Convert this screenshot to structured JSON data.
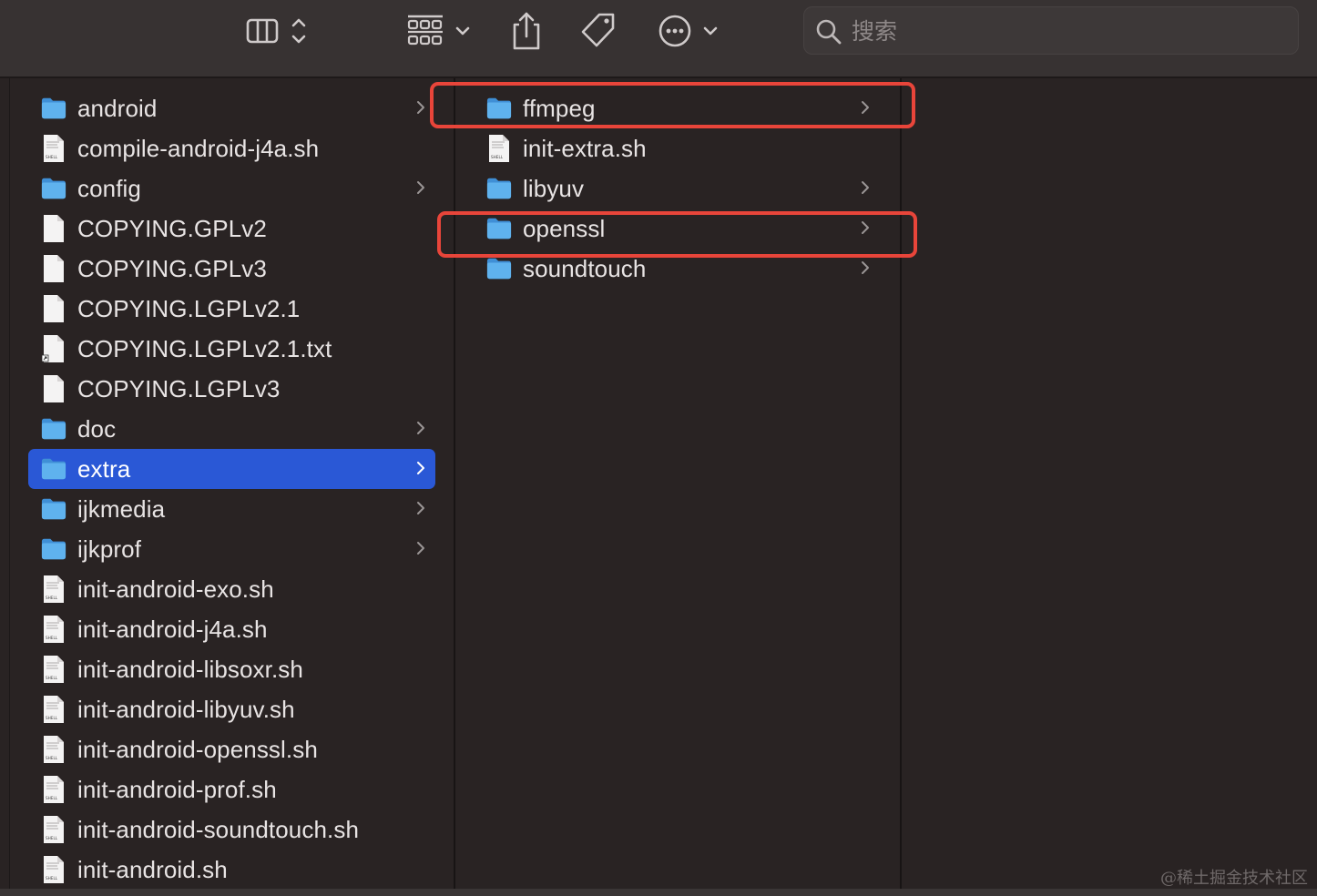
{
  "toolbar": {
    "search_placeholder": "搜索",
    "buttons": [
      "column-view",
      "group-view",
      "share",
      "tags",
      "more-actions"
    ]
  },
  "columns": [
    {
      "items": [
        {
          "label": "android",
          "type": "folder",
          "has_children": true,
          "selected": false
        },
        {
          "label": "compile-android-j4a.sh",
          "type": "shell",
          "has_children": false,
          "selected": false
        },
        {
          "label": "config",
          "type": "folder",
          "has_children": true,
          "selected": false
        },
        {
          "label": "COPYING.GPLv2",
          "type": "file",
          "has_children": false,
          "selected": false
        },
        {
          "label": "COPYING.GPLv3",
          "type": "file",
          "has_children": false,
          "selected": false
        },
        {
          "label": "COPYING.LGPLv2.1",
          "type": "file",
          "has_children": false,
          "selected": false
        },
        {
          "label": "COPYING.LGPLv2.1.txt",
          "type": "alias",
          "has_children": false,
          "selected": false
        },
        {
          "label": "COPYING.LGPLv3",
          "type": "file",
          "has_children": false,
          "selected": false
        },
        {
          "label": "doc",
          "type": "folder",
          "has_children": true,
          "selected": false
        },
        {
          "label": "extra",
          "type": "folder",
          "has_children": true,
          "selected": true
        },
        {
          "label": "ijkmedia",
          "type": "folder",
          "has_children": true,
          "selected": false
        },
        {
          "label": "ijkprof",
          "type": "folder",
          "has_children": true,
          "selected": false
        },
        {
          "label": "init-android-exo.sh",
          "type": "shell",
          "has_children": false,
          "selected": false
        },
        {
          "label": "init-android-j4a.sh",
          "type": "shell",
          "has_children": false,
          "selected": false
        },
        {
          "label": "init-android-libsoxr.sh",
          "type": "shell",
          "has_children": false,
          "selected": false
        },
        {
          "label": "init-android-libyuv.sh",
          "type": "shell",
          "has_children": false,
          "selected": false
        },
        {
          "label": "init-android-openssl.sh",
          "type": "shell",
          "has_children": false,
          "selected": false
        },
        {
          "label": "init-android-prof.sh",
          "type": "shell",
          "has_children": false,
          "selected": false
        },
        {
          "label": "init-android-soundtouch.sh",
          "type": "shell",
          "has_children": false,
          "selected": false
        },
        {
          "label": "init-android.sh",
          "type": "shell",
          "has_children": false,
          "selected": false
        }
      ]
    },
    {
      "items": [
        {
          "label": "ffmpeg",
          "type": "folder",
          "has_children": true,
          "selected": false,
          "highlighted": true
        },
        {
          "label": "init-extra.sh",
          "type": "shell",
          "has_children": false,
          "selected": false
        },
        {
          "label": "libyuv",
          "type": "folder",
          "has_children": true,
          "selected": false
        },
        {
          "label": "openssl",
          "type": "folder",
          "has_children": true,
          "selected": false,
          "highlighted": true
        },
        {
          "label": "soundtouch",
          "type": "folder",
          "has_children": true,
          "selected": false
        }
      ]
    },
    {
      "items": []
    }
  ],
  "colors": {
    "selection": "#2a58d6",
    "annotation": "#e8453a",
    "folder": "#5fb2ee"
  },
  "watermark": "@稀土掘金技术社区"
}
